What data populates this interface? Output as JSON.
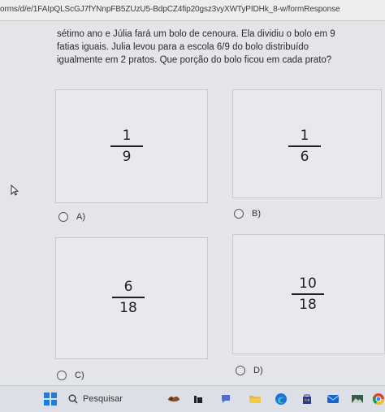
{
  "browser": {
    "url": "orms/d/e/1FAIpQLScGJ7fYNnpFB5ZUzU5-BdpCZ4fip20gsz3vyXWTyPIDHk_8-w/formResponse"
  },
  "question": {
    "lines": [
      "sétimo ano e Júlia  fará um bolo de cenoura. Ela dividiu o bolo em 9",
      "fatias iguais. Julia levou para a escola 6/9 do bolo distribuído",
      "igualmente em 2 pratos. Que porção do bolo ficou em cada prato?"
    ]
  },
  "options": [
    {
      "label": "A)",
      "numerator": "1",
      "denominator": "9"
    },
    {
      "label": "B)",
      "numerator": "1",
      "denominator": "6"
    },
    {
      "label": "C)",
      "numerator": "6",
      "denominator": "18"
    },
    {
      "label": "D)",
      "numerator": "10",
      "denominator": "18"
    }
  ],
  "taskbar": {
    "search_label": "Pesquisar"
  },
  "colors": {
    "start_blue": "#1f7be0",
    "edge_blue": "#1a73d9",
    "explorer_yellow": "#e8b530"
  }
}
